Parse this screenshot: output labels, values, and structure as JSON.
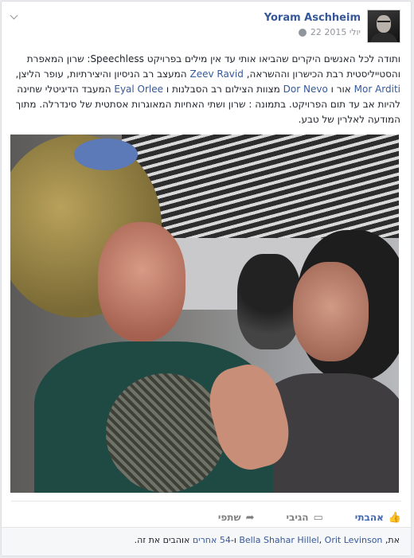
{
  "post": {
    "author": "Yoram Aschheim",
    "date": "22 יולי 2015",
    "text_parts": [
      {
        "t": "ותודה לכל האנשים היקרים שהביאו אותי עד אין מילים בפרויקט Speechless: שרון המאפרת והסטייליסטית רבת הכישרון וההשראה,",
        "link": false
      },
      {
        "t": "Zeev Ravid",
        "link": true
      },
      {
        "t": "המעצב רב הניסיון והיצירתיות, עופר הליצן,",
        "link": false
      },
      {
        "t": "Mor Arditi",
        "link": true
      },
      {
        "t": "אור ו",
        "link": false
      },
      {
        "t": "Dor Nevo",
        "link": true
      },
      {
        "t": "מצוות הצילום רב הסבלנות ו",
        "link": false
      },
      {
        "t": "Eyal Orlee",
        "link": true
      },
      {
        "t": "המעבד הדיגיטלי שחינה להיות אב עד תום הפרויקט. בתמונה : שרון ושתי האחיות המאוגרות אסתטית של סינדרלה. מתוך המודעה לאלרין של טבע.",
        "link": false
      }
    ]
  },
  "actions": {
    "like": "אהבתי",
    "comment": "הגיבי",
    "share": "שתפי"
  },
  "footer": {
    "prefix": "את,",
    "names": [
      "Bella Shahar Hillel",
      "Orit Levinson"
    ],
    "sep": ",",
    "and": "ו-",
    "others_count": "54",
    "others": "אחרים",
    "suffix": "אוהבים את זה."
  },
  "icons": {
    "like": "thumbs-up-icon",
    "comment": "comment-icon",
    "share": "share-icon",
    "privacy": "globe-icon",
    "menu": "chevron-down-icon"
  },
  "colors": {
    "link": "#365899",
    "like_active": "#4267b2",
    "muted": "#90949c"
  }
}
